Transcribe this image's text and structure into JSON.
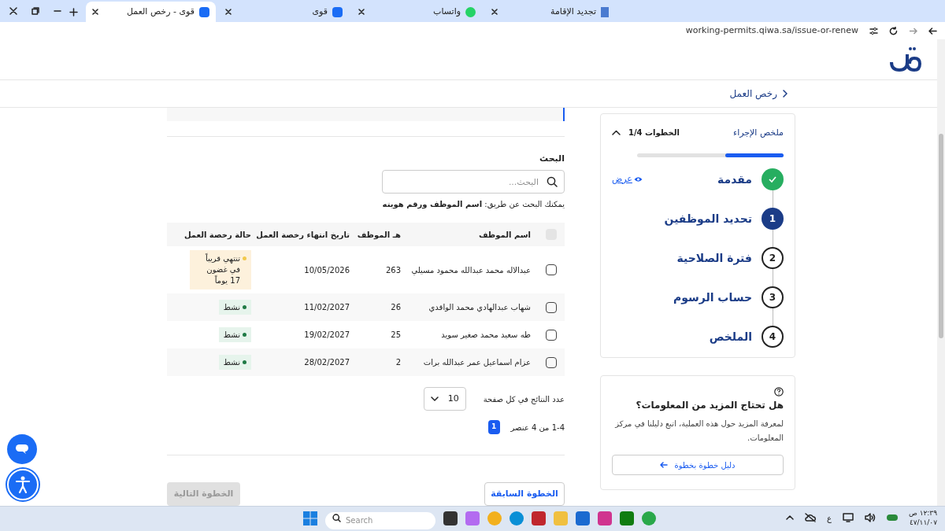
{
  "browser": {
    "tabs": [
      {
        "title": "تجديد الإقامة",
        "kind": "flag",
        "selected": false
      },
      {
        "title": "واتساب",
        "kind": "chat",
        "selected": false
      },
      {
        "title": "قوى",
        "kind": "site",
        "selected": false
      },
      {
        "title": "قوى - رخص العمل",
        "kind": "site",
        "selected": true
      }
    ],
    "url": "working-permits.qiwa.sa/issue-or-renew"
  },
  "breadcrumb": "رخص العمل",
  "search": {
    "label": "البحث",
    "placeholder": "البحث...",
    "hint": "يمكنك البحث عن طريق: **اسم الموظف ورقم هويته**"
  },
  "table": {
    "select_all_checked": false,
    "columns": [
      "اسم الموظف",
      "هـ الموظف",
      "تاريخ انتهاء رخصة العمل",
      "حالة رخصة العمل"
    ],
    "rows": [
      {
        "checked": false,
        "name": "عبدالاله محمد عبدالله محمود مسيلي",
        "column_3": "263",
        "expiry": "10/05/2026",
        "status": {
          "kind": "warning",
          "text": "تنتهي قريباً في غضون 17 يوماً"
        }
      },
      {
        "checked": false,
        "name": "شهاب عبدالهادي محمد الواقدي",
        "column_3": "26",
        "expiry": "11/02/2027",
        "status": {
          "kind": "active",
          "text": "نشط"
        }
      },
      {
        "checked": false,
        "name": "طه سعيد محمد صغير سويد",
        "column_3": "25",
        "expiry": "19/02/2027",
        "status": {
          "kind": "active",
          "text": "نشط"
        }
      },
      {
        "checked": false,
        "name": "عزام اسماعيل عمر عبدالله برات",
        "column_3": "2",
        "expiry": "28/02/2027",
        "status": {
          "kind": "active",
          "text": "نشط"
        }
      }
    ]
  },
  "pagination": {
    "per_page_label": "عدد النتائج في كل صفحة",
    "per_page": "10",
    "range": "1-4 من 4 عنصر",
    "pages": [
      {
        "label": "1",
        "selected": true
      }
    ]
  },
  "buttons": {
    "previous": {
      "label": "الخطوة السابقة",
      "disabled": false
    },
    "next": {
      "label": "الخطوة التالية",
      "disabled": true
    }
  },
  "summary": {
    "title": "ملخص الإجراء",
    "steps_count": "الخطوات 1/4",
    "expanded": true,
    "level": 0.4,
    "steps": [
      {
        "label": "مقدمة",
        "kind": "done",
        "view_link": "عرض"
      },
      {
        "label": "تحديد الموظفين",
        "kind": "current",
        "number": "1"
      },
      {
        "label": "فترة الصلاحية",
        "kind": "pending",
        "number": "2"
      },
      {
        "label": "حساب الرسوم",
        "kind": "pending",
        "number": "3"
      },
      {
        "label": "الملخص",
        "kind": "pending",
        "number": "4"
      }
    ]
  },
  "help": {
    "title": "هل تحتاج المزيد من المعلومات؟",
    "text": "لمعرفة المزيد حول هذه العملية، اتبع دليلنا في مركز المعلومات.",
    "button": "دليل خطوة بخطوة"
  },
  "taskbar": {
    "search_placeholder": "Search",
    "language": "ع",
    "time": "١٢:٣٩ ص",
    "date": "٤٧/١١/٠٧"
  }
}
